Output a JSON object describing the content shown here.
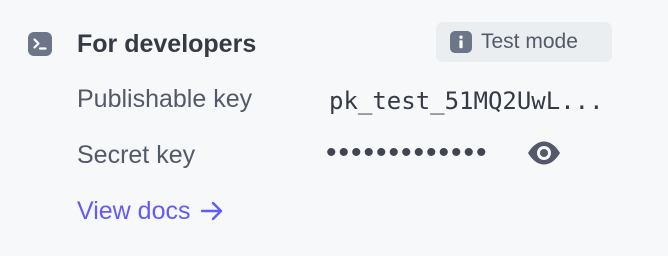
{
  "section": {
    "title": "For developers",
    "icon": "terminal-icon",
    "badge": {
      "label": "Test mode",
      "icon": "info-icon"
    }
  },
  "rows": {
    "publishable_key": {
      "label": "Publishable key",
      "value": "pk_test_51MQ2UwL..."
    },
    "secret_key": {
      "label": "Secret key",
      "value": "•••••••••••••",
      "reveal_icon": "eye-icon"
    }
  },
  "docs_link": {
    "label": "View docs",
    "icon": "arrow-right-icon"
  },
  "colors": {
    "background": "#f6f8fa",
    "badge_background": "#ebeef1",
    "icon_gray": "#6c7688",
    "link": "#625afa",
    "text_primary": "#353a44",
    "text_secondary": "#545969"
  }
}
